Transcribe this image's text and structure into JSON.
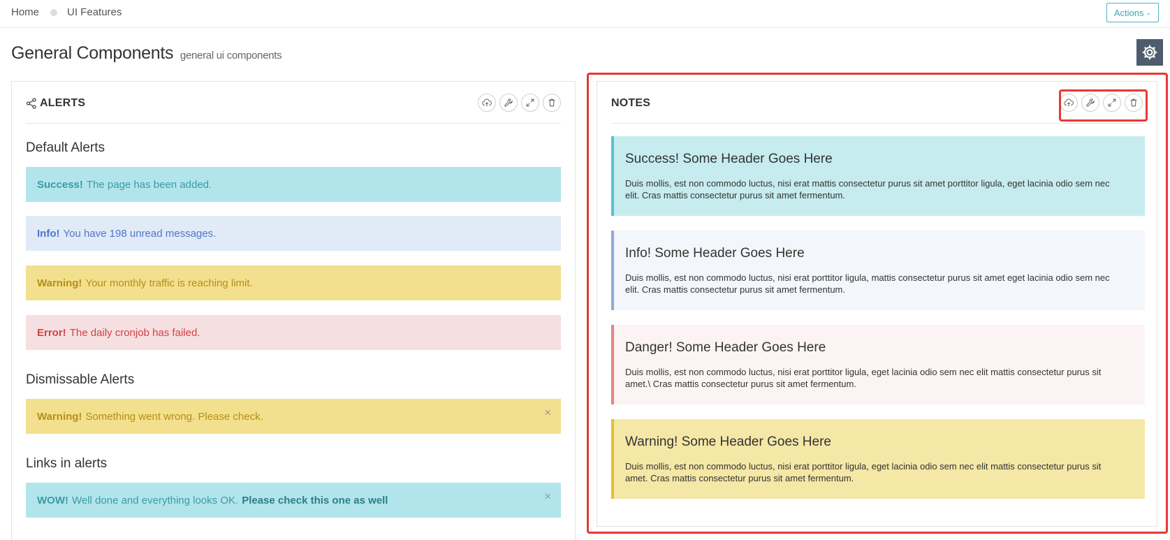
{
  "breadcrumb": {
    "home": "Home",
    "current": "UI Features"
  },
  "header": {
    "actions_label": "Actions",
    "title": "General Components",
    "subtitle": "general ui components"
  },
  "alerts_panel": {
    "title": "ALERTS",
    "tools": [
      "cloud-upload-icon",
      "wrench-icon",
      "expand-icon",
      "trash-icon"
    ],
    "default_title": "Default Alerts",
    "default_alerts": [
      {
        "type": "success",
        "strong": "Success!",
        "text": "The page has been added."
      },
      {
        "type": "info",
        "strong": "Info!",
        "text": "You have 198 unread messages."
      },
      {
        "type": "warning",
        "strong": "Warning!",
        "text": "Your monthly traffic is reaching limit."
      },
      {
        "type": "error",
        "strong": "Error!",
        "text": "The daily cronjob has failed."
      }
    ],
    "dismissable_title": "Dismissable Alerts",
    "dismissable_alert": {
      "strong": "Warning!",
      "text": "Something went wrong. Please check.",
      "close": "×"
    },
    "links_title": "Links in alerts",
    "link_alert": {
      "strong": "WOW!",
      "text": "Well done and everything looks OK.",
      "link": "Please check this one as well",
      "close": "×"
    }
  },
  "notes_panel": {
    "title": "NOTES",
    "tools": [
      "cloud-upload-icon",
      "wrench-icon",
      "expand-icon",
      "trash-icon"
    ],
    "notes": [
      {
        "type": "success",
        "title": "Success! Some Header Goes Here",
        "body": "Duis mollis, est non commodo luctus, nisi erat mattis consectetur purus sit amet porttitor ligula, eget lacinia odio sem nec elit. Cras mattis consectetur purus sit amet fermentum."
      },
      {
        "type": "info",
        "title": "Info! Some Header Goes Here",
        "body": "Duis mollis, est non commodo luctus, nisi erat porttitor ligula, mattis consectetur purus sit amet eget lacinia odio sem nec elit. Cras mattis consectetur purus sit amet fermentum."
      },
      {
        "type": "danger",
        "title": "Danger! Some Header Goes Here",
        "body": "Duis mollis, est non commodo luctus, nisi erat porttitor ligula, eget lacinia odio sem nec elit mattis consectetur purus sit amet.\\ Cras mattis consectetur purus sit amet fermentum."
      },
      {
        "type": "warning",
        "title": "Warning! Some Header Goes Here",
        "body": "Duis mollis, est non commodo luctus, nisi erat porttitor ligula, eget lacinia odio sem nec elit mattis consectetur purus sit amet. Cras mattis consectetur purus sit amet fermentum."
      }
    ]
  },
  "colors": {
    "accent": "#3aa6b7",
    "highlight": "#e53935",
    "gear_bg": "#4d5d6e"
  }
}
